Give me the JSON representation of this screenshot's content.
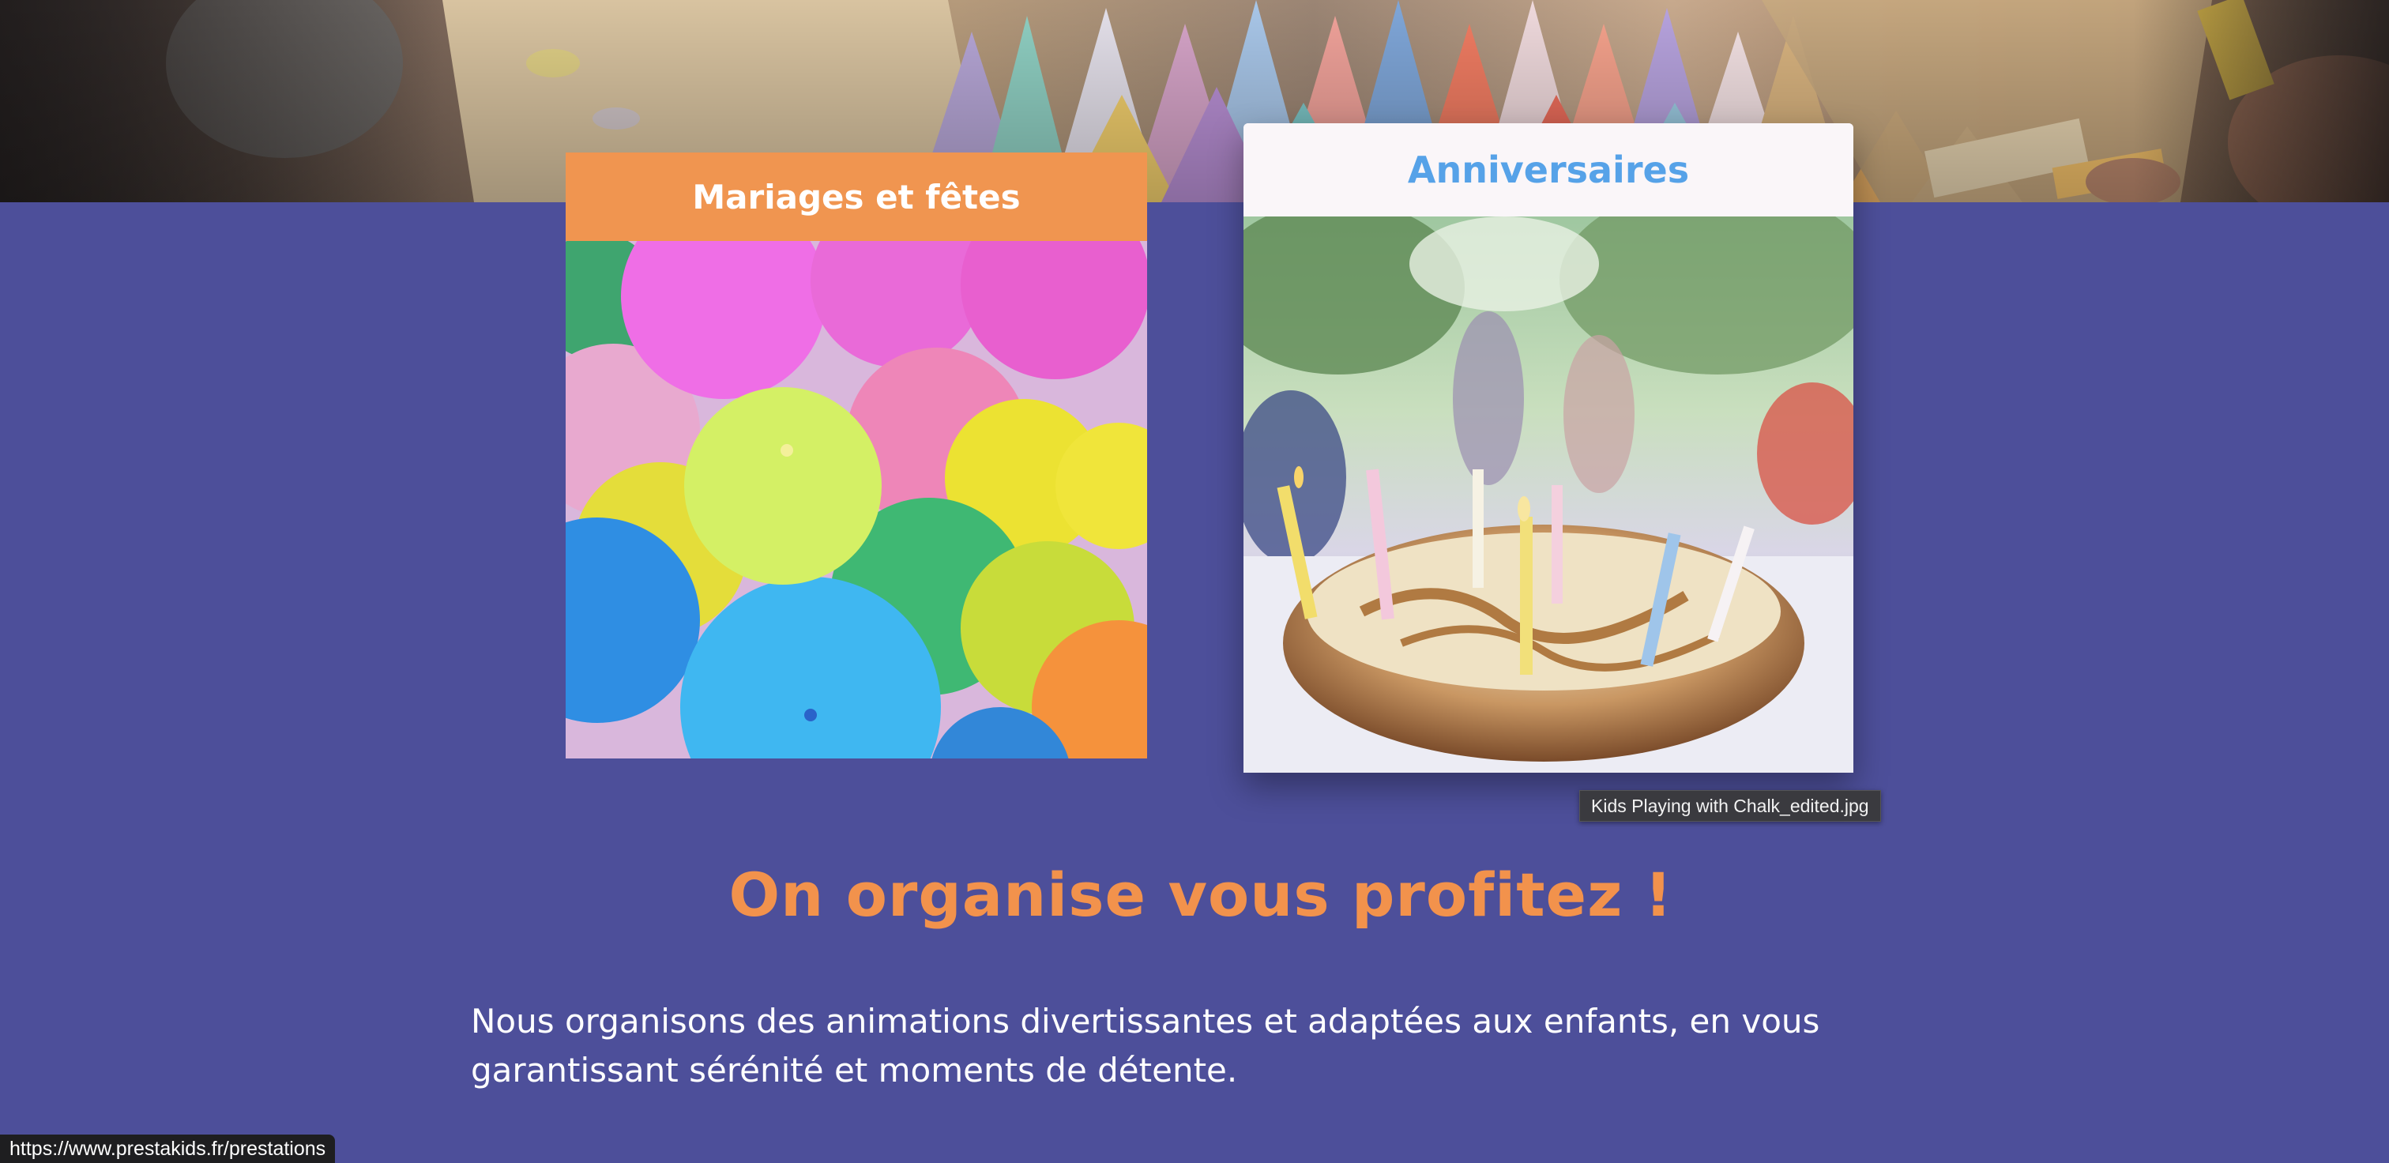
{
  "hero": {
    "image": "chalk-sticks-photo"
  },
  "cards": [
    {
      "title": "Mariages et fêtes",
      "image": "colorful-balloons-photo"
    },
    {
      "title": "Anniversaires",
      "image": "birthday-cake-candles-photo"
    }
  ],
  "tooltip": {
    "text": "Kids Playing with Chalk_edited.jpg"
  },
  "section": {
    "headline": "On organise vous profitez !",
    "paragraph_line1": "Nous organisons des animations divertissantes et adaptées aux enfants, en vous",
    "paragraph_line2": "garantissant sérénité et moments de détente."
  },
  "status_bar": {
    "url": "https://www.prestakids.fr/prestations"
  },
  "colors": {
    "background": "#4d4f9a",
    "accent_orange": "#f09550",
    "accent_blue": "#56a2e8",
    "headline_orange": "#f2924c"
  }
}
